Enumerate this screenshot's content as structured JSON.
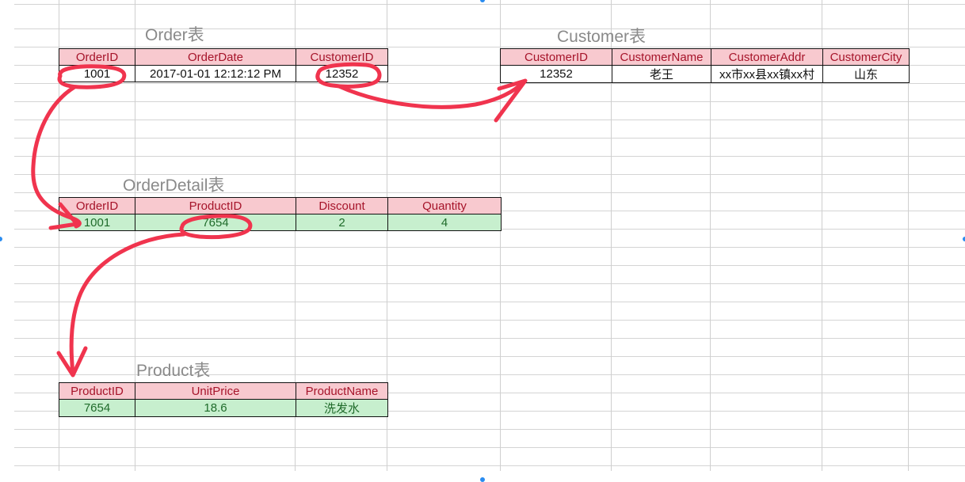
{
  "tables": {
    "order": {
      "title": "Order表",
      "headers": [
        "OrderID",
        "OrderDate",
        "CustomerID"
      ],
      "row": [
        "1001",
        "2017-01-01  12:12:12 PM",
        "12352"
      ]
    },
    "customer": {
      "title": "Customer表",
      "headers": [
        "CustomerID",
        "CustomerName",
        "CustomerAddr",
        "CustomerCity"
      ],
      "row": [
        "12352",
        "老王",
        "xx市xx县xx镇xx村",
        "山东"
      ]
    },
    "orderdetail": {
      "title": "OrderDetail表",
      "headers": [
        "OrderID",
        "ProductID",
        "Discount",
        "Quantity"
      ],
      "row": [
        "1001",
        "7654",
        "2",
        "4"
      ]
    },
    "product": {
      "title": "Product表",
      "headers": [
        "ProductID",
        "UnitPrice",
        "ProductName"
      ],
      "row": [
        "7654",
        "18.6",
        "洗发水"
      ]
    }
  },
  "colors": {
    "header_fill": "#f8c9cf",
    "header_text": "#a6142a",
    "data_fill_green": "#c7efce",
    "data_text_green": "#1f6b2a",
    "annotation": "#f0344e",
    "gridline": "#d4d4d4"
  },
  "annotations": {
    "links": [
      {
        "from": "Order.OrderID",
        "to": "OrderDetail.OrderID"
      },
      {
        "from": "Order.CustomerID",
        "to": "Customer.CustomerID"
      },
      {
        "from": "OrderDetail.ProductID",
        "to": "Product.ProductID"
      }
    ]
  }
}
